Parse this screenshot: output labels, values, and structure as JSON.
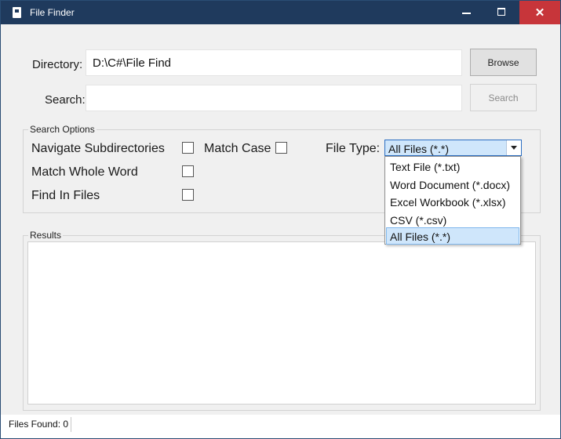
{
  "window": {
    "title": "File Finder",
    "controls": {
      "minimize": "–",
      "maximize": "□",
      "close": "✕"
    }
  },
  "form": {
    "directory_label": "Directory:",
    "directory_value": "D:\\C#\\File Find",
    "search_label": "Search:",
    "search_value": "",
    "browse_label": "Browse",
    "search_button_label": "Search"
  },
  "search_options": {
    "title": "Search Options",
    "navigate_subdirectories": {
      "label": "Navigate Subdirectories",
      "checked": false
    },
    "match_case": {
      "label": "Match Case",
      "checked": false
    },
    "match_whole_word": {
      "label": "Match Whole Word",
      "checked": false
    },
    "find_in_files": {
      "label": "Find In Files",
      "checked": false
    },
    "file_type_label": "File Type:",
    "file_type_selected": "All Files (*.*)",
    "file_type_options": [
      "Text File (*.txt)",
      "Word Document (*.docx)",
      "Excel Workbook (*.xlsx)",
      "CSV (*.csv)",
      "All Files (*.*)"
    ]
  },
  "results": {
    "title": "Results"
  },
  "status": {
    "files_found": "Files Found: 0"
  }
}
